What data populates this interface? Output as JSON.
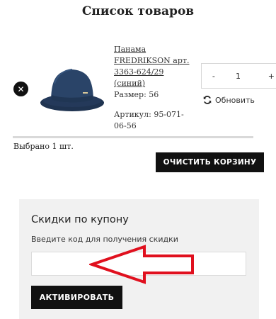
{
  "page": {
    "title": "Список товаров"
  },
  "cart": {
    "items": [
      {
        "name": "Панама FREDRIKSON арт. 3363-624/29 (синий)",
        "size": "Размер: 56",
        "sku": "Артикул: 95-071-06-56",
        "quantity": "1",
        "qty_minus": "-",
        "qty_plus": "+",
        "remove_icon": "close-icon",
        "refresh_label": "Обновить",
        "refresh_icon": "refresh-icon"
      }
    ],
    "selected_count": "Выбрано 1 шт.",
    "clear_label": "ОЧИСТИТЬ КОРЗИНУ"
  },
  "coupon": {
    "title": "Скидки по купону",
    "hint": "Введите код для получения скидки",
    "value": "",
    "activate_label": "АКТИВИРОВАТЬ"
  },
  "colors": {
    "button_bg": "#111111",
    "panel_bg": "#f1f1f1",
    "arrow": "#e0101e"
  }
}
